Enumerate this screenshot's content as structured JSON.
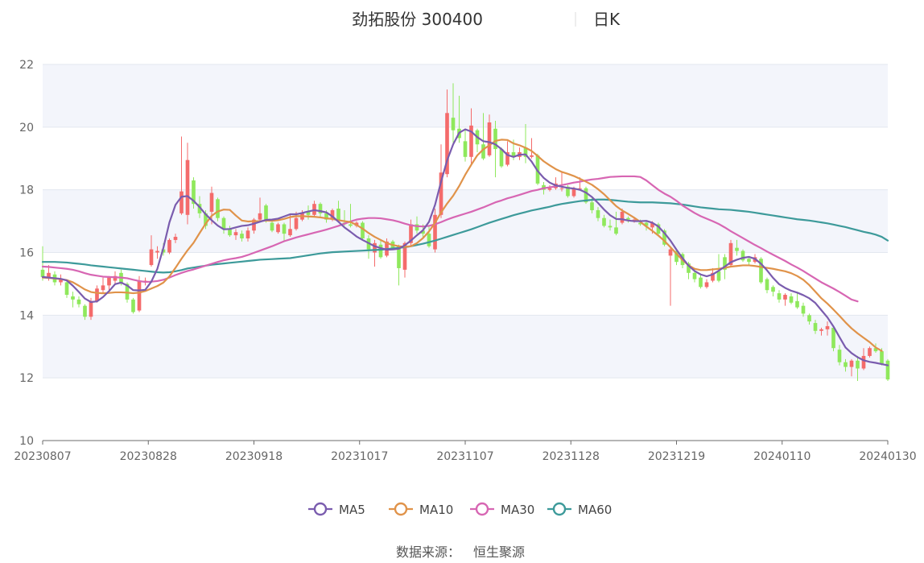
{
  "title": "劲拓股份 300400",
  "period": "日K",
  "source_label": "数据来源：",
  "source_name": "恒生聚源",
  "colors": {
    "up": "#f46b6b",
    "down": "#8fe85c",
    "ma5": "#7a5cae",
    "ma10": "#e0934a",
    "ma30": "#d766b3",
    "ma60": "#3d9a9a",
    "band": "#f3f5fb",
    "grid": "#e3e7ef",
    "axis": "#6b6b6b"
  },
  "chart_data": {
    "type": "candlestick",
    "ylim": [
      10,
      22
    ],
    "yticks": [
      10,
      12,
      14,
      16,
      18,
      20,
      22
    ],
    "xticks": [
      "20230807",
      "20230828",
      "20230918",
      "20231017",
      "20231107",
      "20231128",
      "20231219",
      "20240110",
      "20240130"
    ],
    "legend": [
      "MA5",
      "MA10",
      "MA30",
      "MA60"
    ],
    "candles": [
      [
        15.45,
        15.22,
        16.2,
        15.1
      ],
      [
        15.2,
        15.35,
        15.6,
        15.1
      ],
      [
        15.3,
        15.05,
        15.4,
        14.95
      ],
      [
        15.05,
        15.15,
        15.3,
        14.95
      ],
      [
        15.05,
        14.65,
        15.1,
        14.55
      ],
      [
        14.6,
        14.5,
        14.75,
        14.25
      ],
      [
        14.5,
        14.35,
        14.6,
        14.25
      ],
      [
        14.3,
        13.95,
        14.35,
        13.85
      ],
      [
        13.95,
        14.45,
        14.55,
        13.85
      ],
      [
        14.45,
        14.85,
        14.95,
        14.4
      ],
      [
        14.8,
        14.95,
        15.2,
        14.7
      ],
      [
        14.95,
        15.2,
        15.25,
        14.8
      ],
      [
        15.1,
        15.25,
        15.4,
        15.0
      ],
      [
        15.35,
        15.0,
        15.45,
        14.95
      ],
      [
        15.0,
        14.5,
        15.05,
        14.4
      ],
      [
        14.5,
        14.1,
        14.55,
        14.05
      ],
      [
        14.15,
        15.1,
        15.25,
        14.1
      ],
      [
        15.1,
        15.1,
        15.2,
        14.95
      ],
      [
        15.6,
        16.1,
        16.55,
        15.55
      ],
      [
        16.0,
        16.05,
        16.2,
        15.8
      ],
      [
        16.1,
        16.0,
        16.3,
        15.9
      ],
      [
        16.0,
        16.4,
        16.45,
        15.95
      ],
      [
        16.4,
        16.5,
        16.6,
        16.3
      ],
      [
        17.25,
        17.95,
        19.7,
        17.2
      ],
      [
        17.2,
        18.95,
        19.5,
        16.9
      ],
      [
        18.3,
        17.55,
        18.4,
        17.4
      ],
      [
        17.55,
        17.25,
        17.8,
        17.1
      ],
      [
        17.25,
        16.85,
        17.35,
        16.75
      ],
      [
        17.3,
        17.9,
        18.1,
        16.9
      ],
      [
        17.7,
        17.1,
        17.75,
        17.0
      ],
      [
        17.1,
        16.75,
        17.15,
        16.6
      ],
      [
        16.75,
        16.55,
        16.85,
        16.5
      ],
      [
        16.55,
        16.65,
        16.75,
        16.4
      ],
      [
        16.6,
        16.45,
        16.7,
        16.35
      ],
      [
        16.45,
        16.7,
        16.8,
        16.35
      ],
      [
        16.7,
        17.05,
        17.1,
        16.6
      ],
      [
        17.05,
        17.25,
        17.75,
        17.0
      ],
      [
        17.5,
        17.05,
        17.55,
        16.95
      ],
      [
        16.95,
        16.7,
        17.05,
        16.65
      ],
      [
        16.65,
        16.9,
        16.95,
        16.6
      ],
      [
        16.9,
        16.6,
        16.95,
        16.35
      ],
      [
        16.55,
        16.75,
        17.2,
        16.5
      ],
      [
        16.75,
        17.1,
        17.3,
        16.7
      ],
      [
        17.05,
        17.25,
        17.35,
        17.0
      ],
      [
        17.3,
        17.2,
        17.5,
        17.05
      ],
      [
        17.2,
        17.55,
        17.65,
        17.15
      ],
      [
        17.55,
        17.25,
        17.6,
        17.1
      ],
      [
        17.25,
        17.05,
        17.35,
        16.95
      ],
      [
        17.05,
        17.35,
        17.4,
        17.0
      ],
      [
        17.4,
        17.0,
        17.65,
        16.95
      ],
      [
        16.95,
        16.9,
        17.35,
        16.85
      ],
      [
        16.9,
        16.85,
        17.55,
        16.8
      ],
      [
        16.85,
        16.95,
        17.0,
        16.8
      ],
      [
        16.95,
        16.45,
        17.0,
        16.4
      ],
      [
        16.45,
        16.1,
        16.55,
        15.8
      ],
      [
        16.0,
        16.3,
        16.4,
        15.55
      ],
      [
        16.25,
        15.85,
        16.4,
        15.8
      ],
      [
        15.9,
        16.35,
        16.45,
        15.85
      ],
      [
        16.35,
        16.15,
        16.4,
        16.1
      ],
      [
        16.2,
        15.5,
        16.25,
        14.95
      ],
      [
        15.45,
        16.3,
        16.35,
        15.2
      ],
      [
        16.3,
        16.9,
        17.05,
        16.2
      ],
      [
        16.9,
        16.7,
        17.15,
        16.6
      ],
      [
        16.7,
        16.6,
        16.9,
        16.45
      ],
      [
        16.6,
        16.2,
        16.85,
        16.15
      ],
      [
        16.1,
        17.2,
        17.4,
        16.0
      ],
      [
        17.2,
        18.55,
        19.45,
        17.1
      ],
      [
        18.5,
        20.45,
        21.2,
        18.4
      ],
      [
        20.3,
        19.9,
        21.4,
        19.5
      ],
      [
        19.95,
        19.65,
        21.0,
        19.5
      ],
      [
        19.55,
        19.05,
        19.95,
        18.9
      ],
      [
        19.05,
        20.05,
        20.6,
        18.8
      ],
      [
        19.9,
        19.45,
        19.95,
        19.2
      ],
      [
        19.45,
        19.0,
        20.45,
        18.95
      ],
      [
        19.1,
        20.15,
        20.4,
        19.05
      ],
      [
        19.95,
        19.3,
        20.2,
        18.4
      ],
      [
        19.3,
        18.75,
        19.35,
        18.7
      ],
      [
        18.8,
        19.2,
        19.55,
        18.75
      ],
      [
        19.2,
        19.05,
        19.6,
        18.95
      ],
      [
        19.05,
        19.2,
        19.35,
        18.95
      ],
      [
        19.35,
        19.05,
        20.1,
        18.85
      ],
      [
        19.05,
        19.1,
        19.65,
        19.0
      ],
      [
        19.1,
        18.2,
        19.15,
        18.15
      ],
      [
        18.15,
        18.0,
        18.25,
        17.85
      ],
      [
        18.0,
        18.05,
        18.15,
        17.95
      ],
      [
        18.05,
        18.2,
        18.4,
        18.0
      ],
      [
        18.05,
        18.05,
        18.55,
        17.95
      ],
      [
        18.1,
        17.8,
        18.15,
        17.75
      ],
      [
        17.8,
        18.05,
        18.1,
        17.75
      ],
      [
        18.05,
        18.05,
        18.4,
        18.0
      ],
      [
        18.05,
        17.6,
        18.1,
        17.55
      ],
      [
        17.6,
        17.35,
        17.75,
        17.25
      ],
      [
        17.35,
        17.1,
        17.45,
        17.0
      ],
      [
        17.1,
        16.85,
        17.2,
        16.8
      ],
      [
        16.85,
        16.8,
        17.05,
        16.7
      ],
      [
        16.8,
        16.6,
        17.3,
        16.55
      ],
      [
        16.95,
        17.3,
        17.4,
        16.9
      ],
      [
        17.1,
        17.05,
        17.15,
        16.95
      ],
      [
        17.05,
        17.05,
        17.1,
        16.95
      ],
      [
        16.95,
        16.9,
        17.05,
        16.85
      ],
      [
        16.95,
        16.85,
        17.0,
        16.7
      ],
      [
        16.8,
        16.95,
        17.0,
        16.6
      ],
      [
        16.9,
        16.6,
        16.95,
        16.55
      ],
      [
        16.7,
        16.25,
        16.75,
        16.2
      ],
      [
        15.9,
        16.1,
        16.15,
        14.3
      ],
      [
        16.05,
        15.7,
        16.1,
        15.6
      ],
      [
        15.95,
        15.6,
        16.0,
        15.5
      ],
      [
        15.65,
        15.35,
        15.7,
        15.15
      ],
      [
        15.35,
        15.15,
        15.4,
        15.05
      ],
      [
        15.2,
        14.9,
        15.3,
        14.85
      ],
      [
        14.9,
        15.05,
        15.15,
        14.85
      ],
      [
        15.1,
        15.35,
        15.5,
        15.05
      ],
      [
        15.4,
        15.1,
        15.95,
        15.05
      ],
      [
        15.85,
        15.45,
        15.95,
        15.15
      ],
      [
        15.6,
        16.3,
        16.4,
        15.55
      ],
      [
        16.15,
        16.05,
        16.4,
        15.9
      ],
      [
        16.05,
        15.75,
        16.1,
        15.7
      ],
      [
        15.8,
        15.7,
        15.85,
        15.6
      ],
      [
        15.7,
        15.85,
        15.95,
        15.65
      ],
      [
        15.8,
        15.05,
        15.85,
        15.0
      ],
      [
        15.15,
        14.8,
        15.2,
        14.7
      ],
      [
        14.9,
        14.75,
        14.95,
        14.6
      ],
      [
        14.7,
        14.5,
        14.8,
        14.4
      ],
      [
        14.5,
        14.65,
        14.7,
        14.3
      ],
      [
        14.6,
        14.4,
        14.7,
        14.35
      ],
      [
        14.45,
        14.25,
        14.7,
        14.2
      ],
      [
        14.3,
        14.05,
        14.4,
        13.95
      ],
      [
        14.0,
        13.8,
        14.05,
        13.7
      ],
      [
        13.75,
        13.5,
        13.85,
        13.4
      ],
      [
        13.5,
        13.55,
        13.6,
        13.35
      ],
      [
        13.55,
        13.65,
        13.8,
        13.35
      ],
      [
        13.6,
        12.95,
        13.65,
        12.85
      ],
      [
        12.9,
        12.5,
        13.05,
        12.4
      ],
      [
        12.5,
        12.35,
        12.6,
        12.2
      ],
      [
        12.35,
        12.55,
        12.6,
        12.05
      ],
      [
        12.55,
        12.3,
        12.7,
        11.9
      ],
      [
        12.3,
        12.7,
        12.95,
        12.25
      ],
      [
        12.7,
        12.95,
        13.0,
        12.65
      ],
      [
        12.95,
        12.85,
        13.1,
        12.8
      ],
      [
        12.85,
        12.45,
        12.95,
        12.4
      ],
      [
        12.55,
        11.95,
        12.6,
        11.9
      ]
    ],
    "ma5": [
      15.22,
      15.2,
      15.18,
      15.16,
      15.11,
      14.94,
      14.74,
      14.53,
      14.42,
      14.44,
      14.58,
      14.77,
      14.99,
      15.04,
      14.95,
      14.8,
      14.79,
      14.81,
      15.07,
      15.48,
      16.15,
      16.96,
      17.52,
      17.78,
      17.8,
      17.65,
      17.45,
      17.22,
      17.03,
      16.86,
      16.74,
      16.75,
      16.8,
      16.85,
      16.87,
      16.92,
      16.98,
      17.04,
      17.05,
      17.08,
      17.15,
      17.22,
      17.22,
      17.26,
      17.31,
      17.35,
      17.32,
      17.28,
      17.15,
      16.98,
      16.8,
      16.66,
      16.51,
      16.4,
      16.3,
      16.2,
      16.14,
      16.09,
      16.1,
      16.12,
      16.23,
      16.38,
      16.55,
      16.71,
      16.98,
      17.52,
      18.26,
      18.94,
      19.45,
      19.82,
      19.93,
      19.86,
      19.68,
      19.55,
      19.52,
      19.45,
      19.3,
      19.11,
      19.05,
      19.12,
      19.13,
      18.9,
      18.6,
      18.38,
      18.23,
      18.14,
      18.1,
      18.06,
      18.04,
      18.0,
      17.91,
      17.77,
      17.58,
      17.37,
      17.19,
      17.07,
      17.06,
      17.02,
      17.0,
      17.0,
      17.01,
      16.95,
      16.83,
      16.62,
      16.38,
      16.09,
      15.82,
      15.58,
      15.41,
      15.3,
      15.24,
      15.3,
      15.42,
      15.55,
      15.69,
      15.77,
      15.83,
      15.86,
      15.8,
      15.64,
      15.43,
      15.19,
      14.99,
      14.87,
      14.78,
      14.72,
      14.64,
      14.54,
      14.39,
      14.16,
      13.93,
      13.64,
      13.3,
      12.97,
      12.79,
      12.66,
      12.56,
      12.51,
      12.48,
      12.44,
      12.4
    ],
    "ma10": [
      15.2,
      15.19,
      15.17,
      15.15,
      15.12,
      15.05,
      14.94,
      14.82,
      14.74,
      14.71,
      14.7,
      14.71,
      14.73,
      14.73,
      14.72,
      14.7,
      14.72,
      14.77,
      14.85,
      14.93,
      15.04,
      15.24,
      15.51,
      15.8,
      16.07,
      16.31,
      16.62,
      16.92,
      17.17,
      17.31,
      17.37,
      17.36,
      17.18,
      17.02,
      16.99,
      17.0,
      17.0,
      17.02,
      17.01,
      17.03,
      17.07,
      17.13,
      17.16,
      17.16,
      17.15,
      17.14,
      17.12,
      17.09,
      17.07,
      17.03,
      17.0,
      16.97,
      16.88,
      16.76,
      16.62,
      16.5,
      16.4,
      16.3,
      16.24,
      16.2,
      16.18,
      16.2,
      16.3,
      16.46,
      16.67,
      16.95,
      17.28,
      17.56,
      17.81,
      18.12,
      18.48,
      18.8,
      19.1,
      19.29,
      19.42,
      19.56,
      19.6,
      19.59,
      19.48,
      19.42,
      19.34,
      19.24,
      19.08,
      18.91,
      18.78,
      18.66,
      18.57,
      18.51,
      18.44,
      18.35,
      18.26,
      18.16,
      18.02,
      17.86,
      17.67,
      17.48,
      17.34,
      17.23,
      17.11,
      16.98,
      16.83,
      16.69,
      16.54,
      16.37,
      16.17,
      15.96,
      15.76,
      15.59,
      15.48,
      15.44,
      15.44,
      15.46,
      15.48,
      15.51,
      15.55,
      15.57,
      15.59,
      15.59,
      15.57,
      15.54,
      15.51,
      15.48,
      15.44,
      15.4,
      15.34,
      15.25,
      15.13,
      14.96,
      14.75,
      14.54,
      14.37,
      14.18,
      13.98,
      13.77,
      13.58,
      13.42,
      13.28,
      13.14,
      12.97,
      12.86
    ],
    "ma30": [
      15.55,
      15.54,
      15.52,
      15.5,
      15.48,
      15.45,
      15.4,
      15.34,
      15.29,
      15.26,
      15.23,
      15.22,
      15.21,
      15.2,
      15.18,
      15.13,
      15.09,
      15.06,
      15.07,
      15.09,
      15.13,
      15.2,
      15.28,
      15.35,
      15.41,
      15.46,
      15.52,
      15.58,
      15.64,
      15.7,
      15.75,
      15.79,
      15.82,
      15.86,
      15.92,
      15.99,
      16.06,
      16.13,
      16.2,
      16.28,
      16.36,
      16.42,
      16.48,
      16.53,
      16.58,
      16.63,
      16.68,
      16.73,
      16.79,
      16.85,
      16.92,
      16.99,
      17.05,
      17.08,
      17.1,
      17.1,
      17.09,
      17.06,
      17.03,
      16.98,
      16.92,
      16.87,
      16.84,
      16.83,
      16.85,
      16.9,
      16.97,
      17.05,
      17.12,
      17.18,
      17.24,
      17.3,
      17.37,
      17.44,
      17.52,
      17.6,
      17.66,
      17.73,
      17.78,
      17.84,
      17.9,
      17.96,
      18.0,
      18.05,
      18.08,
      18.11,
      18.15,
      18.19,
      18.23,
      18.26,
      18.3,
      18.33,
      18.35,
      18.38,
      18.41,
      18.42,
      18.43,
      18.43,
      18.43,
      18.41,
      18.3,
      18.15,
      18.0,
      17.88,
      17.78,
      17.65,
      17.5,
      17.38,
      17.26,
      17.16,
      17.08,
      17.0,
      16.91,
      16.8,
      16.68,
      16.57,
      16.46,
      16.35,
      16.24,
      16.14,
      16.03,
      15.93,
      15.83,
      15.73,
      15.62,
      15.52,
      15.41,
      15.29,
      15.17,
      15.05,
      14.95,
      14.85,
      14.74,
      14.62,
      14.5,
      14.44
    ],
    "ma60": [
      15.7,
      15.7,
      15.7,
      15.69,
      15.68,
      15.66,
      15.64,
      15.62,
      15.59,
      15.57,
      15.55,
      15.53,
      15.51,
      15.49,
      15.47,
      15.45,
      15.43,
      15.41,
      15.39,
      15.37,
      15.36,
      15.37,
      15.4,
      15.44,
      15.49,
      15.52,
      15.55,
      15.58,
      15.61,
      15.63,
      15.65,
      15.67,
      15.69,
      15.71,
      15.73,
      15.75,
      15.77,
      15.78,
      15.79,
      15.8,
      15.81,
      15.82,
      15.85,
      15.88,
      15.91,
      15.94,
      15.97,
      15.99,
      16.01,
      16.02,
      16.03,
      16.04,
      16.05,
      16.06,
      16.07,
      16.08,
      16.09,
      16.11,
      16.13,
      16.15,
      16.17,
      16.2,
      16.24,
      16.28,
      16.33,
      16.38,
      16.44,
      16.5,
      16.56,
      16.62,
      16.68,
      16.74,
      16.81,
      16.88,
      16.95,
      17.01,
      17.07,
      17.13,
      17.19,
      17.24,
      17.29,
      17.34,
      17.38,
      17.42,
      17.46,
      17.51,
      17.55,
      17.58,
      17.61,
      17.64,
      17.66,
      17.68,
      17.69,
      17.69,
      17.68,
      17.66,
      17.64,
      17.62,
      17.61,
      17.6,
      17.6,
      17.6,
      17.59,
      17.58,
      17.57,
      17.55,
      17.53,
      17.5,
      17.47,
      17.44,
      17.42,
      17.4,
      17.38,
      17.37,
      17.36,
      17.34,
      17.32,
      17.3,
      17.27,
      17.24,
      17.21,
      17.18,
      17.15,
      17.12,
      17.09,
      17.06,
      17.04,
      17.02,
      16.99,
      16.96,
      16.93,
      16.89,
      16.85,
      16.81,
      16.76,
      16.71,
      16.66,
      16.62,
      16.57,
      16.5,
      16.38
    ]
  }
}
